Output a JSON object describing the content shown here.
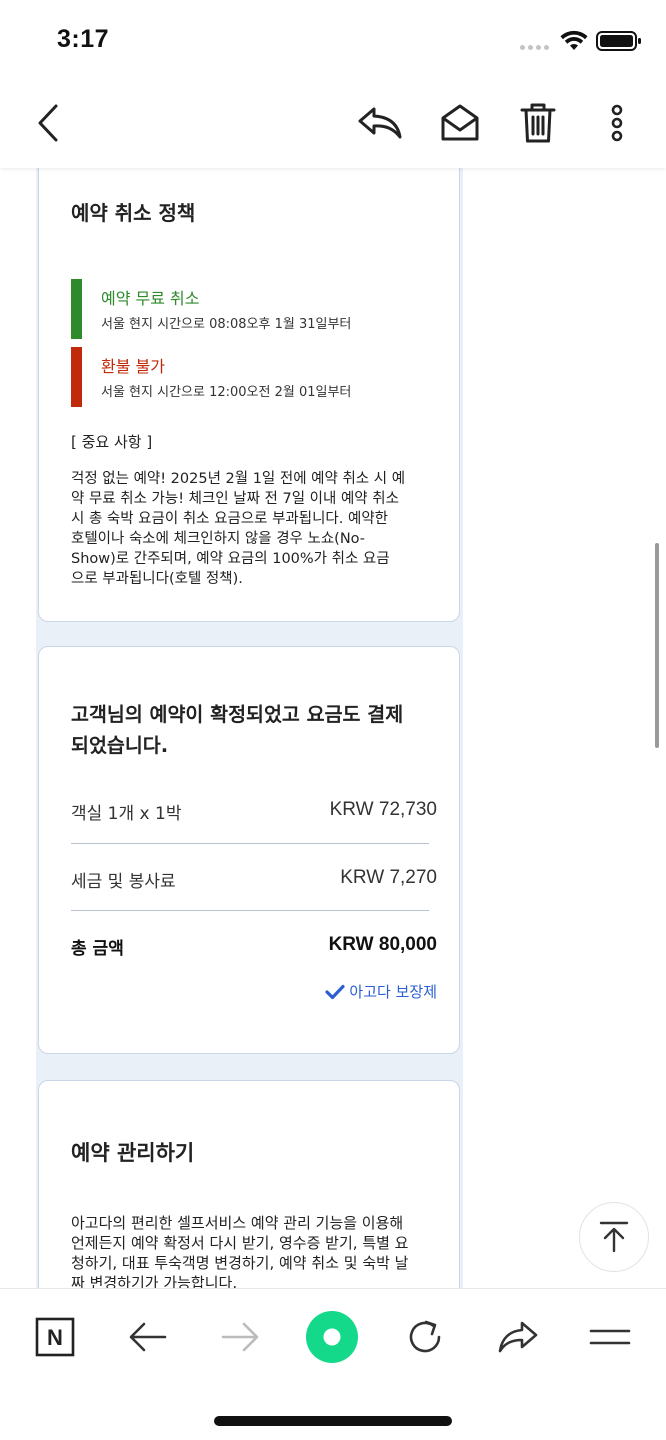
{
  "status_bar": {
    "time": "3:17"
  },
  "toolbar": {
    "back_icon": "chevron-left-icon",
    "reply_icon": "reply-icon",
    "mark_unread_icon": "envelope-open-icon",
    "delete_icon": "trash-icon",
    "more_icon": "more-vertical-icon"
  },
  "cancel_policy": {
    "title": "예약 취소 정책",
    "items": [
      {
        "title": "예약 무료 취소",
        "subtitle": "서울 현지 시간으로 08:08오후 1월 31일부터",
        "color": "#2e8a2a"
      },
      {
        "title": "환불 불가",
        "subtitle": "서울 현지 시간으로 12:00오전 2월 01일부터",
        "color": "#c02a0a"
      }
    ],
    "notice_heading": "[ 중요 사항 ]",
    "notice_lines": [
      "걱정 없는 예약! 2025년 2월 1일 전에 예약 취소 시 예",
      "약 무료 취소 가능! 체크인 날짜 전 7일 이내 예약 취소",
      "시 총 숙박 요금이 취소 요금으로 부과됩니다. 예약한",
      "호텔이나 숙소에 체크인하지 않을 경우 노쇼(No-",
      "Show)로 간주되며, 예약 요금의 100%가 취소 요금",
      "으로 부과됩니다(호텔 정책)."
    ]
  },
  "payment": {
    "title_lines": [
      "고객님의 예약이 확정되었고 요금도 결제",
      "되었습니다."
    ],
    "rows": [
      {
        "label": "객실 1개 x 1박",
        "value": "KRW 72,730"
      },
      {
        "label": "세금 및 봉사료",
        "value": "KRW 7,270"
      }
    ],
    "total": {
      "label": "총 금액",
      "value": "KRW 80,000"
    },
    "guarantee": "아고다 보장제",
    "guarantee_icon": "checkmark-icon",
    "accent_color": "#2b5fd0"
  },
  "manage": {
    "title": "예약 관리하기",
    "body_lines": [
      "아고다의 편리한 셀프서비스 예약 관리 기능을 이용해",
      "언제든지 예약 확정서 다시 받기, 영수증 받기, 특별 요",
      "청하기, 대표 투숙객명 변경하기, 예약 취소 및 숙박 날",
      "짜 변경하기가 가능합니다."
    ]
  },
  "scroll_top_icon": "arrow-up-to-top-icon",
  "bottom_bar": {
    "naver_label": "N",
    "green_dot_color": "#15d98a"
  }
}
